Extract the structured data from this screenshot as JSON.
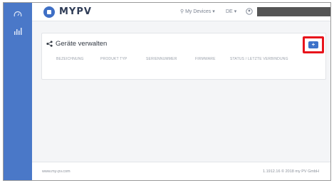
{
  "app": {
    "logo_text": "MYPV"
  },
  "colors": {
    "sidebar": "#4a78c8",
    "accent": "#3d72c9",
    "highlight": "#e8131b"
  },
  "sidebar": {
    "items": [
      {
        "icon": "gauge-icon"
      },
      {
        "icon": "bar-chart-icon"
      }
    ]
  },
  "header": {
    "devices_label": "My Devices",
    "lang_label": "DE",
    "user_name": ""
  },
  "main": {
    "title": "Geräte verwalten",
    "add_label": "+",
    "columns": [
      "BEZEICHNUNG",
      "PRODUKT TYP",
      "SERIENNUMMER",
      "FIRMWARE",
      "STATUS / LETZTE VERBINDUNG"
    ]
  },
  "footer": {
    "left": "www.my-pv.com",
    "right": "1.1912.16 © 2018 my PV GmbH"
  }
}
